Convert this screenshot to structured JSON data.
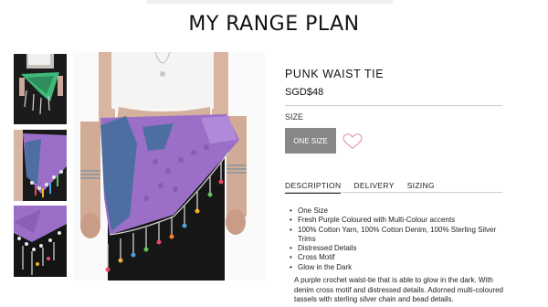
{
  "brand": {
    "title": "MY RANGE PLAN"
  },
  "gallery": {
    "thumbnails": [
      {
        "name": "thumb-1"
      },
      {
        "name": "thumb-2"
      },
      {
        "name": "thumb-3"
      }
    ]
  },
  "product": {
    "name": "PUNK WAIST TIE",
    "price": "SGD$48",
    "size_label": "SIZE",
    "size_option": "ONE SIZE",
    "wishlist_icon": "heart-icon"
  },
  "tabs": [
    {
      "label": "DESCRIPTION",
      "active": true
    },
    {
      "label": "DELIVERY",
      "active": false
    },
    {
      "label": "SIZING",
      "active": false
    }
  ],
  "features": [
    "One Size",
    "Fresh Purple Coloured with Multi-Colour accents",
    "100% Cotton Yarn, 100% Cotton Denim, 100% Sterling Silver Trims",
    "Distressed Details",
    "Cross Motif",
    "Glow in the Dark"
  ],
  "description": "A purple crochet waist-tie that is able to glow in the dark. With denim cross motif and distressed details. Adorned multi-coloured tassels with sterling silver chain and bead details.",
  "colors": {
    "purple": "#9b6fc8",
    "denim": "#4d6ea0",
    "green": "#3fb878",
    "button_gray": "#888888",
    "heart": "#e6a0a8"
  }
}
